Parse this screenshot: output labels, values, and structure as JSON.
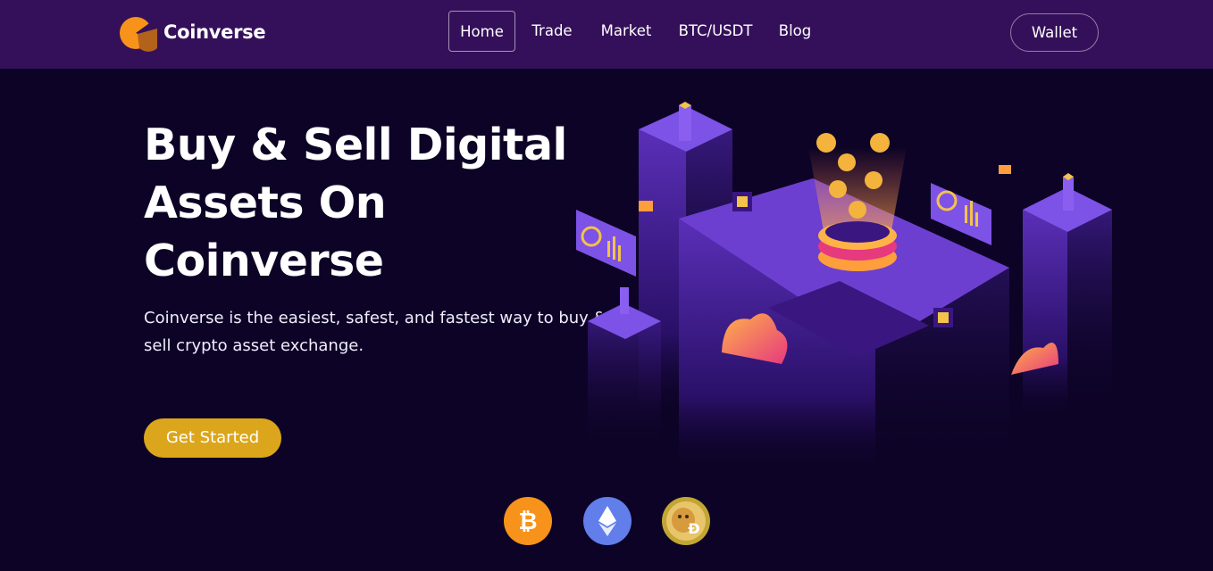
{
  "brand": {
    "name": "Coinverse",
    "logo_icon": "coinverse-logo-icon"
  },
  "nav": {
    "items": [
      {
        "label": "Home",
        "active": true
      },
      {
        "label": "Trade",
        "active": false
      },
      {
        "label": "Market",
        "active": false
      },
      {
        "label": "BTC/USDT",
        "active": false
      },
      {
        "label": "Blog",
        "active": false
      }
    ],
    "wallet_label": "Wallet"
  },
  "hero": {
    "title": "Buy & Sell Digital Assets On Coinverse",
    "description": "Coinverse is the easiest, safest, and fastest way to buy & sell crypto asset exchange.",
    "cta_label": "Get Started"
  },
  "coins": [
    {
      "icon": "bitcoin-icon",
      "color": "#f7931a"
    },
    {
      "icon": "ethereum-icon",
      "color": "#627eea"
    },
    {
      "icon": "dogecoin-icon",
      "color": "#c2a633"
    }
  ],
  "colors": {
    "nav_bg": "#35105a",
    "page_bg": "#0d0326",
    "accent": "#dba61c",
    "platform": "#6c3fd0"
  }
}
